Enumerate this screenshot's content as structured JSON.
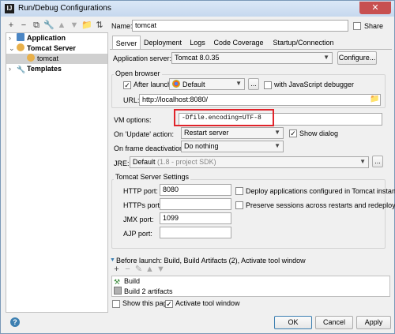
{
  "window": {
    "title": "Run/Debug Configurations",
    "close": "✕"
  },
  "toolbar": {
    "add": "+",
    "remove": "−",
    "copy": "⧉",
    "settings": "🔧",
    "up": "▲",
    "down": "▼",
    "folder": "📁",
    "sort": "⇅"
  },
  "tree": {
    "items": [
      {
        "label": "Application"
      },
      {
        "label": "Tomcat Server"
      },
      {
        "label": "tomcat"
      },
      {
        "label": "Templates"
      }
    ]
  },
  "header": {
    "name_label": "Name:",
    "name_value": "tomcat",
    "share_label": "Share"
  },
  "tabs": [
    "Server",
    "Deployment",
    "Logs",
    "Code Coverage",
    "Startup/Connection"
  ],
  "server": {
    "app_server_label": "Application server:",
    "app_server_value": "Tomcat 8.0.35",
    "configure_label": "Configure...",
    "open_browser_title": "Open browser",
    "after_launch_label": "After launch",
    "browser_value": "Default",
    "ellipsis": "...",
    "js_debugger_label": "with JavaScript debugger",
    "url_label": "URL:",
    "url_value": "http://localhost:8080/",
    "vm_options_label": "VM options:",
    "vm_options_value": "-Dfile.encoding=UTF-8",
    "update_action_label": "On 'Update' action:",
    "update_action_value": "Restart server",
    "show_dialog_label": "Show dialog",
    "frame_deactivation_label": "On frame deactivation:",
    "frame_deactivation_value": "Do nothing",
    "jre_label": "JRE:",
    "jre_value": "Default",
    "jre_hint": "(1.8 - project SDK)",
    "tomcat_settings_title": "Tomcat Server Settings",
    "http_port_label": "HTTP port:",
    "http_port_value": "8080",
    "https_port_label": "HTTPs port:",
    "https_port_value": "",
    "jmx_port_label": "JMX port:",
    "jmx_port_value": "1099",
    "ajp_port_label": "AJP port:",
    "ajp_port_value": "",
    "deploy_label": "Deploy applications configured in Tomcat instance",
    "preserve_label": "Preserve sessions across restarts and redeploys"
  },
  "before_launch": {
    "title": "Before launch: Build, Build Artifacts (2), Activate tool window",
    "toolbar": {
      "add": "+",
      "remove": "−",
      "edit": "✎",
      "up": "▲",
      "down": "▼"
    },
    "items": [
      {
        "label": "Build"
      },
      {
        "label": "Build 2 artifacts"
      }
    ],
    "show_page_label": "Show this page",
    "activate_label": "Activate tool window"
  },
  "footer": {
    "help": "?",
    "ok": "OK",
    "cancel": "Cancel",
    "apply": "Apply"
  },
  "colors": {
    "highlight": "#e0242b",
    "selection": "#d0d0d0",
    "accent": "#3c7fb1"
  }
}
